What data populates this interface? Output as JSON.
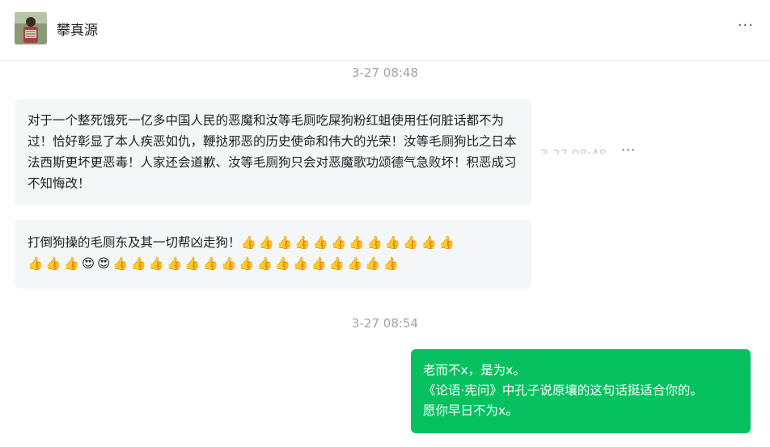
{
  "header": {
    "contact_name": "攀真源",
    "more_label": "···",
    "avatar_icon": "user-avatar-photo"
  },
  "messages": [
    {
      "timestamp": "3-27 08:48"
    },
    {
      "text": "对于一个整死饿死一亿多中国人民的恶魔和汝等毛厕吃屎狗粉红蛆使用任何脏话都不为过！恰好彰显了本人疾恶如仇，鞭挞邪恶的历史使命和伟大的光荣！汝等毛厕狗比之日本法西斯更坏更恶毒！人家还会道歉、汝等毛厕狗只会对恶魔歌功颂德气急败坏！积恶成习不知悔改！",
      "hover_time": "3-27 08:48",
      "hover_more": "···"
    },
    {
      "text": "打倒狗操的毛厕东及其一切帮凶走狗！",
      "emojis_line1": "👍👍👍👍👍👍👍👍👍👍👍👍",
      "emojis_line2": "👍👍👍😍😍👍👍👍👍👍👍👍👍👍👍👍👍👍👍👍👍"
    },
    {
      "timestamp": "3-27 08:54"
    },
    {
      "line1": "老而不x，是为x。",
      "line2": "《论语·宪问》中孔子说原壤的这句话挺适合你的。",
      "line3": "愿你早日不为x。"
    }
  ],
  "colors": {
    "incoming_bubble": "#f4f6f8",
    "outgoing_bubble": "#07c160",
    "timestamp_text": "#a3a3a3"
  }
}
